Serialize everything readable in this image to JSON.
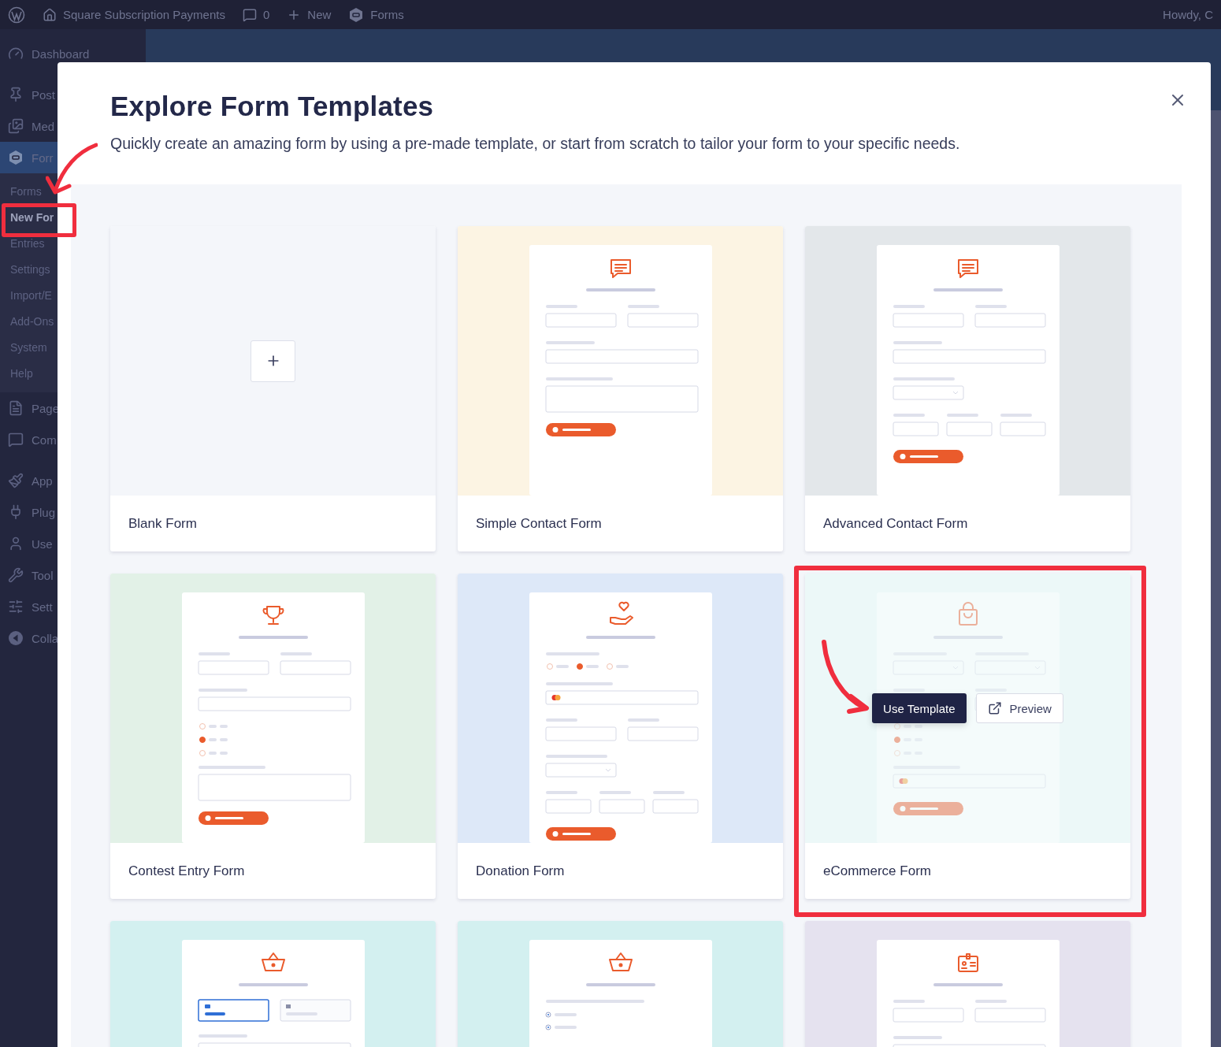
{
  "admin_bar": {
    "site": "Square Subscription Payments",
    "comments": "0",
    "new": "New",
    "forms": "Forms",
    "greeting": "Howdy, C"
  },
  "sidebar": {
    "groups": [
      [
        {
          "label": "Dashboard",
          "selected": false
        }
      ],
      [
        {
          "label": "Post",
          "selected": false
        },
        {
          "label": "Med",
          "selected": false
        },
        {
          "label": "Forr",
          "selected": true,
          "children": [
            {
              "label": "Forms",
              "selected": false
            },
            {
              "label": "New For",
              "selected": true
            },
            {
              "label": "Entries",
              "selected": false
            },
            {
              "label": "Settings",
              "selected": false
            },
            {
              "label": "Import/E",
              "selected": false
            },
            {
              "label": "Add-Ons",
              "selected": false
            },
            {
              "label": "System",
              "selected": false
            },
            {
              "label": "Help",
              "selected": false
            }
          ]
        },
        {
          "label": "Page",
          "selected": false
        },
        {
          "label": "Com",
          "selected": false
        }
      ],
      [
        {
          "label": "App",
          "selected": false
        },
        {
          "label": "Plug",
          "selected": false
        },
        {
          "label": "Use",
          "selected": false
        },
        {
          "label": "Tool",
          "selected": false
        },
        {
          "label": "Sett",
          "selected": false
        },
        {
          "label": "Colla",
          "selected": false
        }
      ]
    ]
  },
  "modal": {
    "title": "Explore Form Templates",
    "subtitle": "Quickly create an amazing form by using a pre-made template, or start from scratch to tailor your form to your specific needs.",
    "actions": {
      "use": "Use Template",
      "preview": "Preview"
    },
    "templates": [
      {
        "kind": "blank",
        "title": "Blank Form",
        "hovered": false
      },
      {
        "kind": "template",
        "title": "Simple Contact Form",
        "hovered": false
      },
      {
        "kind": "template",
        "title": "Advanced Contact Form",
        "hovered": false
      },
      {
        "kind": "template",
        "title": "Contest Entry Form",
        "hovered": false
      },
      {
        "kind": "template",
        "title": "Donation Form",
        "hovered": false
      },
      {
        "kind": "template",
        "title": "eCommerce Form",
        "hovered": true
      },
      {
        "kind": "template",
        "hovered": false
      },
      {
        "kind": "template",
        "hovered": false
      },
      {
        "kind": "template",
        "hovered": false
      }
    ]
  }
}
